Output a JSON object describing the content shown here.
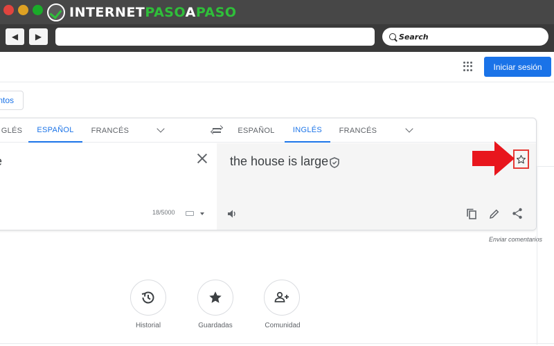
{
  "browser": {
    "logo_part1": "INTERNET",
    "logo_part2": "PASO",
    "logo_part3": "A",
    "logo_part4": "PASO",
    "search_label": "Search",
    "back_icon": "◀",
    "forward_icon": "▶"
  },
  "header": {
    "signin_label": "Iniciar sesión"
  },
  "docs_button_label": "ntos",
  "source_langs": [
    {
      "label": "GLÉS",
      "active": false
    },
    {
      "label": "ESPAÑOL",
      "active": true
    },
    {
      "label": "FRANCÉS",
      "active": false
    }
  ],
  "target_langs": [
    {
      "label": "ESPAÑOL",
      "active": false
    },
    {
      "label": "INGLÉS",
      "active": true
    },
    {
      "label": "FRANCÉS",
      "active": false
    }
  ],
  "source": {
    "text": "e",
    "char_count": "18/5000"
  },
  "target": {
    "text": "the house is large"
  },
  "feedback_label": "Enviar comentarios",
  "bottom_actions": [
    {
      "label": "Historial",
      "icon": "history-icon"
    },
    {
      "label": "Guardadas",
      "icon": "star-icon"
    },
    {
      "label": "Comunidad",
      "icon": "community-icon"
    }
  ],
  "colors": {
    "accent": "#1a73e8",
    "highlight_red": "#e53935",
    "chrome_dark": "#474747"
  }
}
